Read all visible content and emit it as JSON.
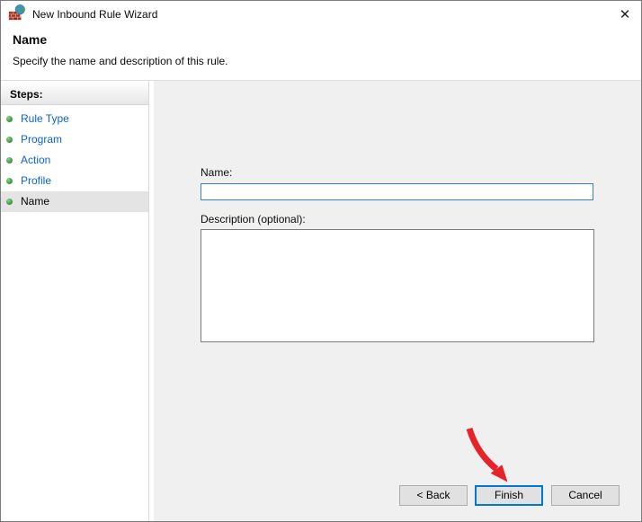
{
  "window": {
    "title": "New Inbound Rule Wizard"
  },
  "icons": {
    "close_glyph": "✕",
    "app_icon": "windows-firewall"
  },
  "header": {
    "title": "Name",
    "subtitle": "Specify the name and description of this rule."
  },
  "sidebar": {
    "heading": "Steps:",
    "items": [
      {
        "label": "Rule Type",
        "state": "visited"
      },
      {
        "label": "Program",
        "state": "visited"
      },
      {
        "label": "Action",
        "state": "visited"
      },
      {
        "label": "Profile",
        "state": "visited"
      },
      {
        "label": "Name",
        "state": "current"
      }
    ]
  },
  "form": {
    "name_label": "Name:",
    "name_value": "",
    "description_label": "Description (optional):",
    "description_value": ""
  },
  "buttons": {
    "back": "< Back",
    "finish": "Finish",
    "cancel": "Cancel"
  },
  "annotation": {
    "shape": "red-arrow",
    "color": "#e62329",
    "points_to": "finish-button"
  },
  "colors": {
    "accent_focus": "#0078d7",
    "link_blue": "#0a64cc",
    "panel_gray": "#f0f0f0",
    "bullet_green": "#46a046",
    "current_row_highlight": "#e4e4e4"
  }
}
